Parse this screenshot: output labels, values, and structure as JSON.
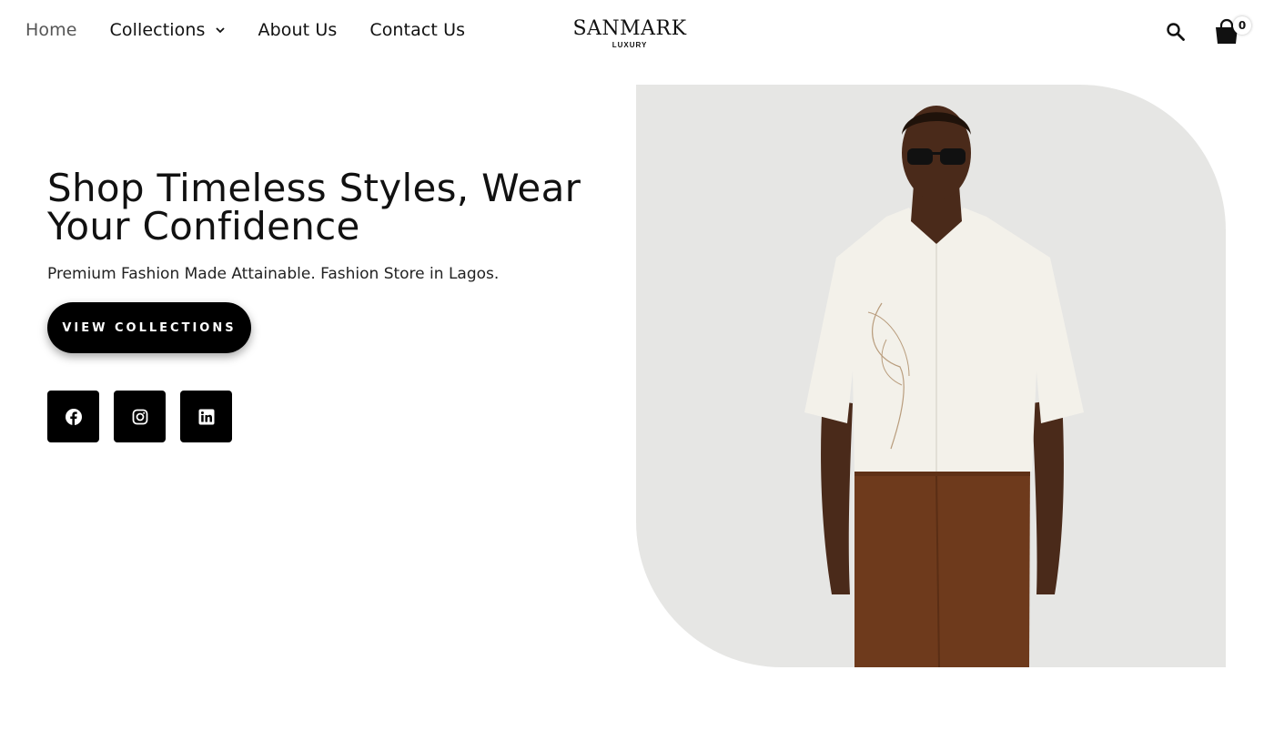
{
  "nav": {
    "items": [
      {
        "label": "Home",
        "active": true
      },
      {
        "label": "Collections",
        "has_dropdown": true
      },
      {
        "label": "About Us"
      },
      {
        "label": "Contact Us"
      }
    ]
  },
  "logo": {
    "main": "SANMARK",
    "sub": "LUXURY"
  },
  "header": {
    "search_icon": "search-icon",
    "cart_icon": "shopping-bag-icon",
    "cart_count": "0"
  },
  "hero": {
    "title": "Shop Timeless Styles, Wear Your Confidence",
    "subtitle": "Premium Fashion Made Attainable. Fashion Store in Lagos.",
    "cta_label": "VIEW COLLECTIONS",
    "image_alt": "Model wearing white embroidered shirt and brown trousers"
  },
  "socials": [
    {
      "name": "facebook",
      "icon": "facebook-icon"
    },
    {
      "name": "instagram",
      "icon": "instagram-icon"
    },
    {
      "name": "linkedin",
      "icon": "linkedin-icon"
    }
  ],
  "colors": {
    "accent": "#000000",
    "hero_bg": "#e6e6e4",
    "text": "#111111"
  }
}
